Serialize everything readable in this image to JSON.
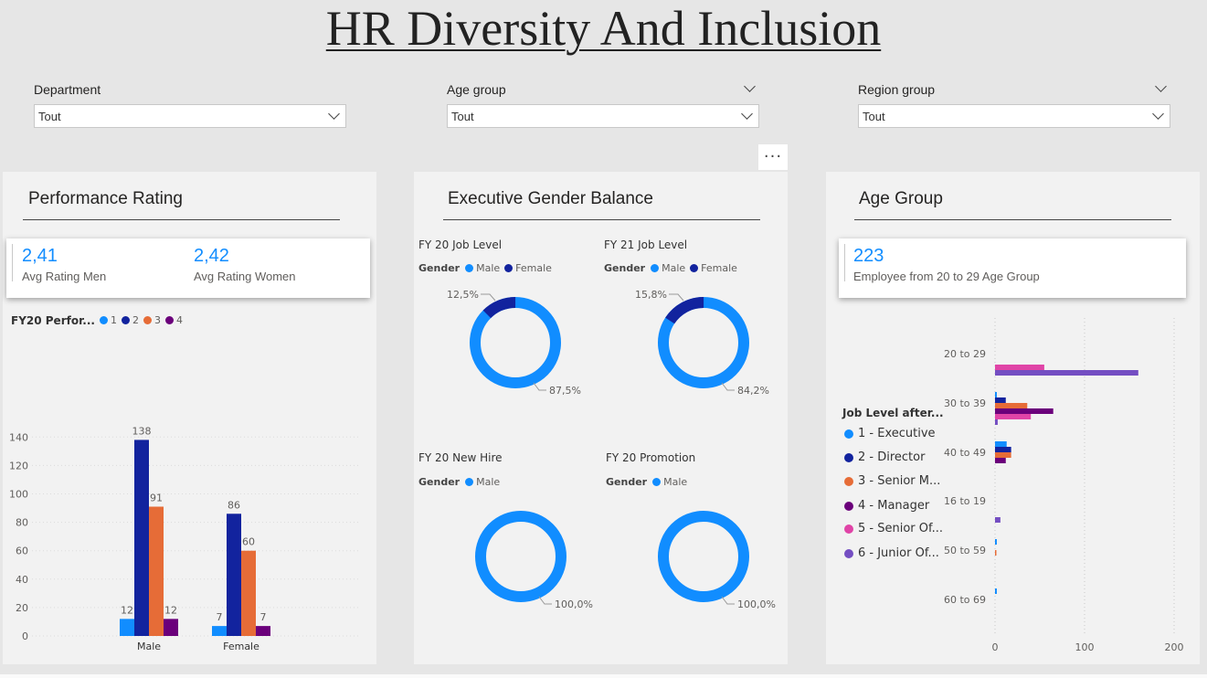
{
  "title": "HR Diversity And Inclusion",
  "colors": {
    "c1": "#118dff",
    "c2": "#12239e",
    "c3": "#e66c37",
    "c4": "#6b007b",
    "c5": "#e044a7",
    "c6": "#744ec2"
  },
  "filters": {
    "department": {
      "label": "Department",
      "value": "Tout"
    },
    "age_group": {
      "label": "Age group",
      "value": "Tout"
    },
    "region_group": {
      "label": "Region group",
      "value": "Tout"
    }
  },
  "more_options": "···",
  "performance": {
    "title": "Performance Rating",
    "men": {
      "value": "2,41",
      "label": "Avg Rating Men"
    },
    "women": {
      "value": "2,42",
      "label": "Avg Rating Women"
    },
    "chart_title": "FY20 Perfor...",
    "legend": [
      "1",
      "2",
      "3",
      "4"
    ]
  },
  "gender_balance": {
    "title": "Executive Gender Balance",
    "gender_label": "Gender",
    "male": "Male",
    "female": "Female",
    "donuts": [
      {
        "title": "FY 20 Job Level",
        "male_label": "87,5%",
        "female_label": "12,5%"
      },
      {
        "title": "FY 21 Job Level",
        "male_label": "84,2%",
        "female_label": "15,8%"
      },
      {
        "title": "FY 20 New Hire",
        "male_label": "100,0%"
      },
      {
        "title": "FY 20 Promotion",
        "male_label": "100,0%"
      }
    ]
  },
  "age": {
    "title": "Age Group",
    "kpi": {
      "value": "223",
      "label": "Employee from 20 to 29 Age Group"
    },
    "legend_title": "Job Level after...",
    "legend": [
      "1 - Executive",
      "2 - Director",
      "3 - Senior M...",
      "4 - Manager",
      "5 - Senior Of...",
      "6 - Junior Of..."
    ]
  },
  "chart_data": [
    {
      "type": "bar",
      "title": "FY20 Perfor...",
      "categories": [
        "Male",
        "Female"
      ],
      "series": [
        {
          "name": "1",
          "values": [
            12,
            7
          ]
        },
        {
          "name": "2",
          "values": [
            138,
            86
          ]
        },
        {
          "name": "3",
          "values": [
            91,
            60
          ]
        },
        {
          "name": "4",
          "values": [
            12,
            7
          ]
        }
      ],
      "ylim": [
        0,
        150
      ],
      "yticks": [
        0,
        20,
        40,
        60,
        80,
        100,
        120,
        140
      ]
    },
    {
      "type": "pie",
      "title": "FY 20 Job Level",
      "labels": [
        "Male",
        "Female"
      ],
      "values": [
        87.5,
        12.5
      ]
    },
    {
      "type": "pie",
      "title": "FY 21 Job Level",
      "labels": [
        "Male",
        "Female"
      ],
      "values": [
        84.2,
        15.8
      ]
    },
    {
      "type": "pie",
      "title": "FY 20 New Hire",
      "labels": [
        "Male"
      ],
      "values": [
        100.0
      ]
    },
    {
      "type": "pie",
      "title": "FY 20 Promotion",
      "labels": [
        "Male"
      ],
      "values": [
        100.0
      ]
    },
    {
      "type": "bar",
      "orientation": "horizontal",
      "title": "",
      "categories": [
        "20 to 29",
        "30 to 39",
        "40 to 49",
        "16 to 19",
        "50 to 59",
        "60 to 69"
      ],
      "series": [
        {
          "name": "1 - Executive",
          "values": [
            0,
            2,
            13,
            0,
            2,
            2
          ]
        },
        {
          "name": "2 - Director",
          "values": [
            0,
            12,
            18,
            0,
            0,
            0
          ]
        },
        {
          "name": "3 - Senior M...",
          "values": [
            0,
            36,
            18,
            0,
            1,
            0
          ]
        },
        {
          "name": "4 - Manager",
          "values": [
            0,
            65,
            12,
            0,
            0,
            0
          ]
        },
        {
          "name": "5 - Senior Of...",
          "values": [
            55,
            40,
            0,
            0,
            0,
            0
          ]
        },
        {
          "name": "6 - Junior Of...",
          "values": [
            160,
            3,
            0,
            6,
            0,
            0
          ]
        }
      ],
      "xlim": [
        0,
        220
      ],
      "xticks": [
        0,
        100,
        200
      ]
    }
  ]
}
